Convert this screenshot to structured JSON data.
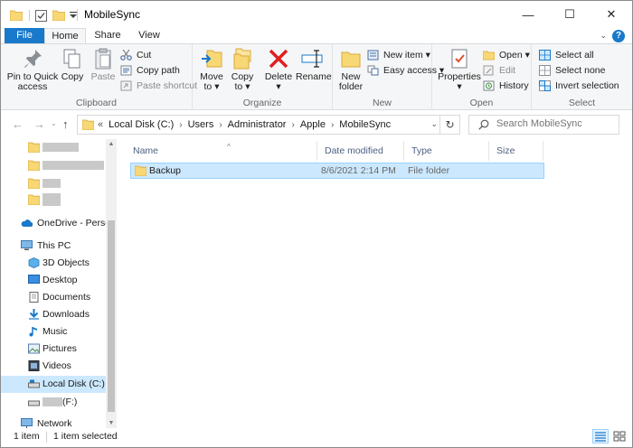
{
  "window": {
    "title": "MobileSync",
    "controls": {
      "minimize": "—",
      "maximize": "☐",
      "close": "✕"
    }
  },
  "tabs": [
    {
      "label": "File"
    },
    {
      "label": "Home"
    },
    {
      "label": "Share"
    },
    {
      "label": "View"
    }
  ],
  "help": "?",
  "ribbon": {
    "clipboard": {
      "label": "Clipboard",
      "pin": "Pin to Quick access",
      "pin_l1": "Pin to Quick",
      "pin_l2": "access",
      "copy": "Copy",
      "paste": "Paste",
      "cut": "Cut",
      "copy_path": "Copy path",
      "paste_shortcut": "Paste shortcut"
    },
    "organize": {
      "label": "Organize",
      "move_to": "Move",
      "move_to_2": "to ▾",
      "copy_to": "Copy",
      "copy_to_2": "to ▾",
      "delete": "Delete",
      "delete_2": "▾",
      "rename": "Rename"
    },
    "new": {
      "label": "New",
      "new_folder": "New",
      "new_folder_2": "folder",
      "new_item": "New item ▾",
      "easy_access": "Easy access ▾"
    },
    "open": {
      "label": "Open",
      "properties": "Properties",
      "properties_2": "▾",
      "open": "Open ▾",
      "edit": "Edit",
      "history": "History"
    },
    "select": {
      "label": "Select",
      "select_all": "Select all",
      "select_none": "Select none",
      "invert": "Invert selection"
    }
  },
  "address": {
    "prefix": "«",
    "crumbs": [
      "Local Disk (C:)",
      "Users",
      "Administrator",
      "Apple",
      "MobileSync"
    ],
    "sep": "›"
  },
  "search": {
    "placeholder": "Search MobileSync"
  },
  "nav": {
    "onedrive": "OneDrive - Persor",
    "this_pc": "This PC",
    "items": [
      "3D Objects",
      "Desktop",
      "Documents",
      "Downloads",
      "Music",
      "Pictures",
      "Videos",
      "Local Disk (C:)"
    ],
    "drive_f": "(F:)",
    "network": "Network"
  },
  "columns": {
    "name": "Name",
    "date": "Date modified",
    "type": "Type",
    "size": "Size"
  },
  "files": [
    {
      "name": "Backup",
      "date": "8/6/2021 2:14 PM",
      "type": "File folder",
      "size": ""
    }
  ],
  "status": {
    "count": "1 item",
    "selected": "1 item selected"
  },
  "colors": {
    "accent": "#1979ca",
    "selection": "#cce8ff",
    "folder": "#f8d775"
  }
}
